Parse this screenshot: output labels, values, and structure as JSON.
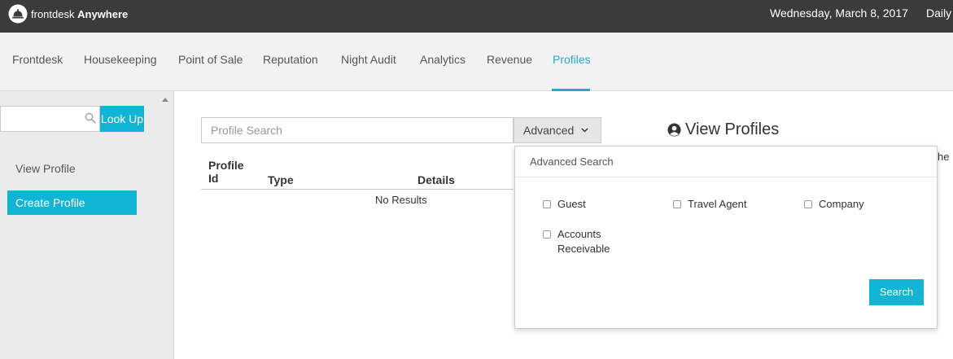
{
  "header": {
    "brand_prefix": "frontdesk",
    "brand_suffix": "Anywhere",
    "date": "Wednesday, March 8, 2017",
    "daily": "Daily"
  },
  "nav": {
    "items": [
      {
        "label": "Frontdesk"
      },
      {
        "label": "Housekeeping"
      },
      {
        "label": "Point of Sale"
      },
      {
        "label": "Reputation"
      },
      {
        "label": "Night Audit"
      },
      {
        "label": "Analytics"
      },
      {
        "label": "Revenue"
      },
      {
        "label": "Profiles",
        "active": true
      }
    ],
    "accent_color": "#26a9cf"
  },
  "sidebar": {
    "search_value": "",
    "lookup_label": "Look Up",
    "view_profile_label": "View Profile",
    "create_profile_label": "Create Profile",
    "button_color": "#12b4d6"
  },
  "main": {
    "search_placeholder": "Profile Search",
    "advanced_label": "Advanced",
    "columns": {
      "profile_id_line1": "Profile",
      "profile_id_line2": "Id",
      "type": "Type",
      "details": "Details"
    },
    "empty_text": "No Results",
    "view_title": "View Profiles",
    "cut_text": "he p"
  },
  "advanced_search": {
    "title": "Advanced Search",
    "options": [
      {
        "label": "Guest",
        "checked": false
      },
      {
        "label": "Travel Agent",
        "checked": false
      },
      {
        "label": "Company",
        "checked": false
      },
      {
        "label_line1": "Accounts",
        "label_line2": "Receivable",
        "checked": false
      }
    ],
    "search_label": "Search"
  },
  "icons": {
    "logo": "bell-icon",
    "search": "search-icon",
    "chevron": "chevron-down-icon",
    "user": "user-circle-icon",
    "scroll": "scroll-up-arrow-icon"
  }
}
